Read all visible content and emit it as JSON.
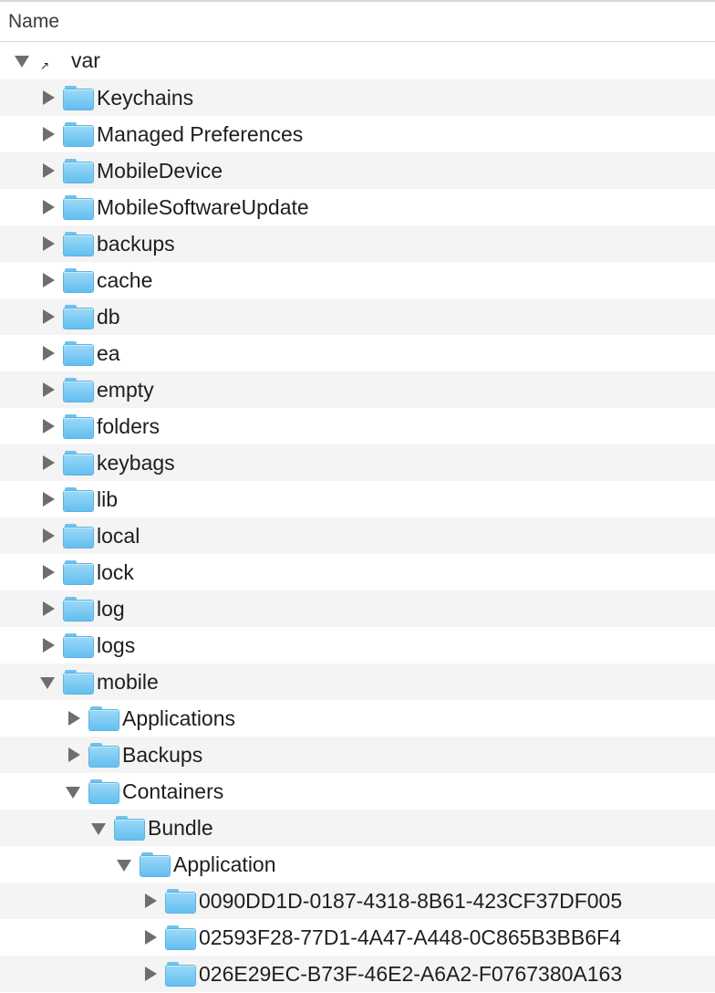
{
  "window": {
    "column_header": "Name"
  },
  "tree": {
    "root": {
      "label": "var",
      "expanded": true,
      "alias_glyph": "↗",
      "icon": "alias-icon"
    },
    "rows": [
      {
        "label": "Keychains",
        "expanded": false,
        "depth": 1
      },
      {
        "label": "Managed Preferences",
        "expanded": false,
        "depth": 1
      },
      {
        "label": "MobileDevice",
        "expanded": false,
        "depth": 1
      },
      {
        "label": "MobileSoftwareUpdate",
        "expanded": false,
        "depth": 1
      },
      {
        "label": "backups",
        "expanded": false,
        "depth": 1
      },
      {
        "label": "cache",
        "expanded": false,
        "depth": 1
      },
      {
        "label": "db",
        "expanded": false,
        "depth": 1
      },
      {
        "label": "ea",
        "expanded": false,
        "depth": 1
      },
      {
        "label": "empty",
        "expanded": false,
        "depth": 1
      },
      {
        "label": "folders",
        "expanded": false,
        "depth": 1
      },
      {
        "label": "keybags",
        "expanded": false,
        "depth": 1
      },
      {
        "label": "lib",
        "expanded": false,
        "depth": 1
      },
      {
        "label": "local",
        "expanded": false,
        "depth": 1
      },
      {
        "label": "lock",
        "expanded": false,
        "depth": 1
      },
      {
        "label": "log",
        "expanded": false,
        "depth": 1
      },
      {
        "label": "logs",
        "expanded": false,
        "depth": 1
      },
      {
        "label": "mobile",
        "expanded": true,
        "depth": 1
      },
      {
        "label": "Applications",
        "expanded": false,
        "depth": 2
      },
      {
        "label": "Backups",
        "expanded": false,
        "depth": 2
      },
      {
        "label": "Containers",
        "expanded": true,
        "depth": 2
      },
      {
        "label": "Bundle",
        "expanded": true,
        "depth": 3
      },
      {
        "label": "Application",
        "expanded": true,
        "depth": 4
      },
      {
        "label": "0090DD1D-0187-4318-8B61-423CF37DF005",
        "expanded": false,
        "depth": 5
      },
      {
        "label": "02593F28-77D1-4A47-A448-0C865B3BB6F4",
        "expanded": false,
        "depth": 5
      },
      {
        "label": "026E29EC-B73F-46E2-A6A2-F0767380A163",
        "expanded": false,
        "depth": 5
      }
    ]
  },
  "colors": {
    "row_alt": "#f4f4f4",
    "folder": "#63bff0",
    "disclosure": "#6e6e6e"
  }
}
